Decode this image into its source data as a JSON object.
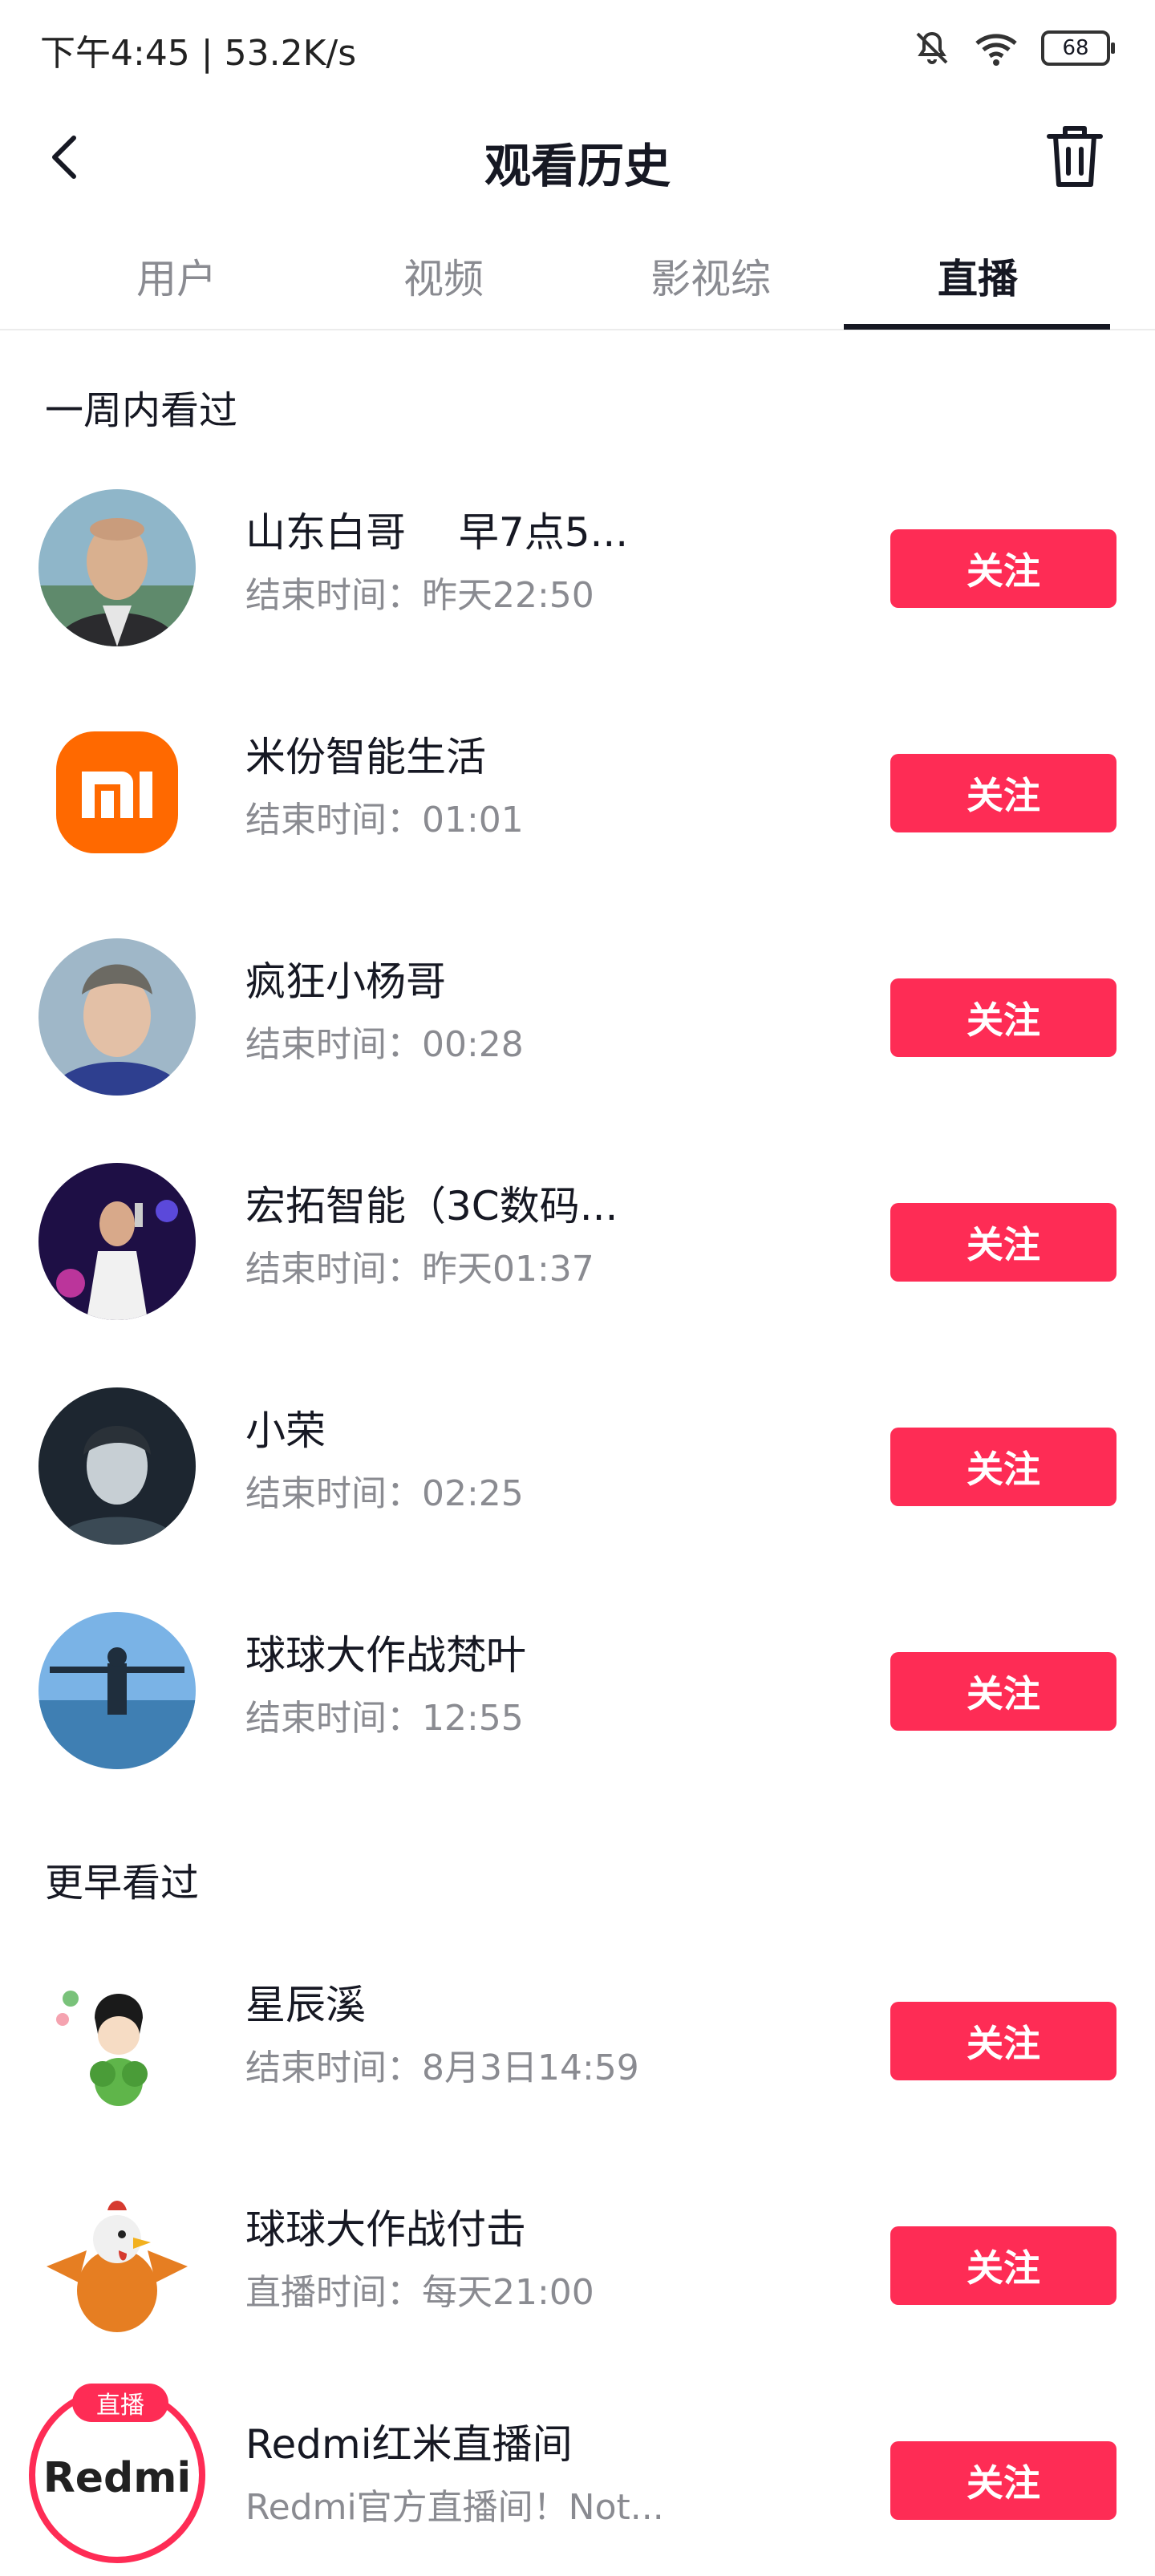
{
  "status_bar": {
    "time_speed": "下午4:45 | 53.2K/s",
    "battery": "68",
    "icons": [
      "mute-icon",
      "wifi-icon",
      "battery-icon"
    ]
  },
  "header": {
    "title": "观看历史",
    "back_icon": "back-arrow-icon",
    "trash_icon": "trash-icon"
  },
  "tabs": [
    {
      "label": "用户"
    },
    {
      "label": "视频"
    },
    {
      "label": "影视综"
    },
    {
      "label": "直播",
      "active": true
    }
  ],
  "sections": {
    "week": {
      "title": "一周内看过"
    },
    "earlier": {
      "title": "更早看过"
    }
  },
  "follow_label": "关注",
  "live_badge": "直播",
  "redmi_logo": "Redmi",
  "accent_color": "#fe2c55",
  "items": [
    {
      "name": "山东白哥　 早7点5...",
      "subtitle": "结束时间：昨天22:50"
    },
    {
      "name": "米份智能生活",
      "subtitle": "结束时间：01:01"
    },
    {
      "name": "疯狂小杨哥",
      "subtitle": "结束时间：00:28"
    },
    {
      "name": "宏拓智能（3C数码...",
      "subtitle": "结束时间：昨天01:37"
    },
    {
      "name": "小荣",
      "subtitle": "结束时间：02:25"
    },
    {
      "name": "球球大作战梵叶",
      "subtitle": "结束时间：12:55"
    },
    {
      "name": "星辰溪",
      "subtitle": "结束时间：8月3日14:59"
    },
    {
      "name": "球球大作战付击",
      "subtitle": "直播时间：每天21:00"
    },
    {
      "name": "Redmi红米直播间",
      "subtitle": "Redmi官方直播间！Not..."
    }
  ]
}
